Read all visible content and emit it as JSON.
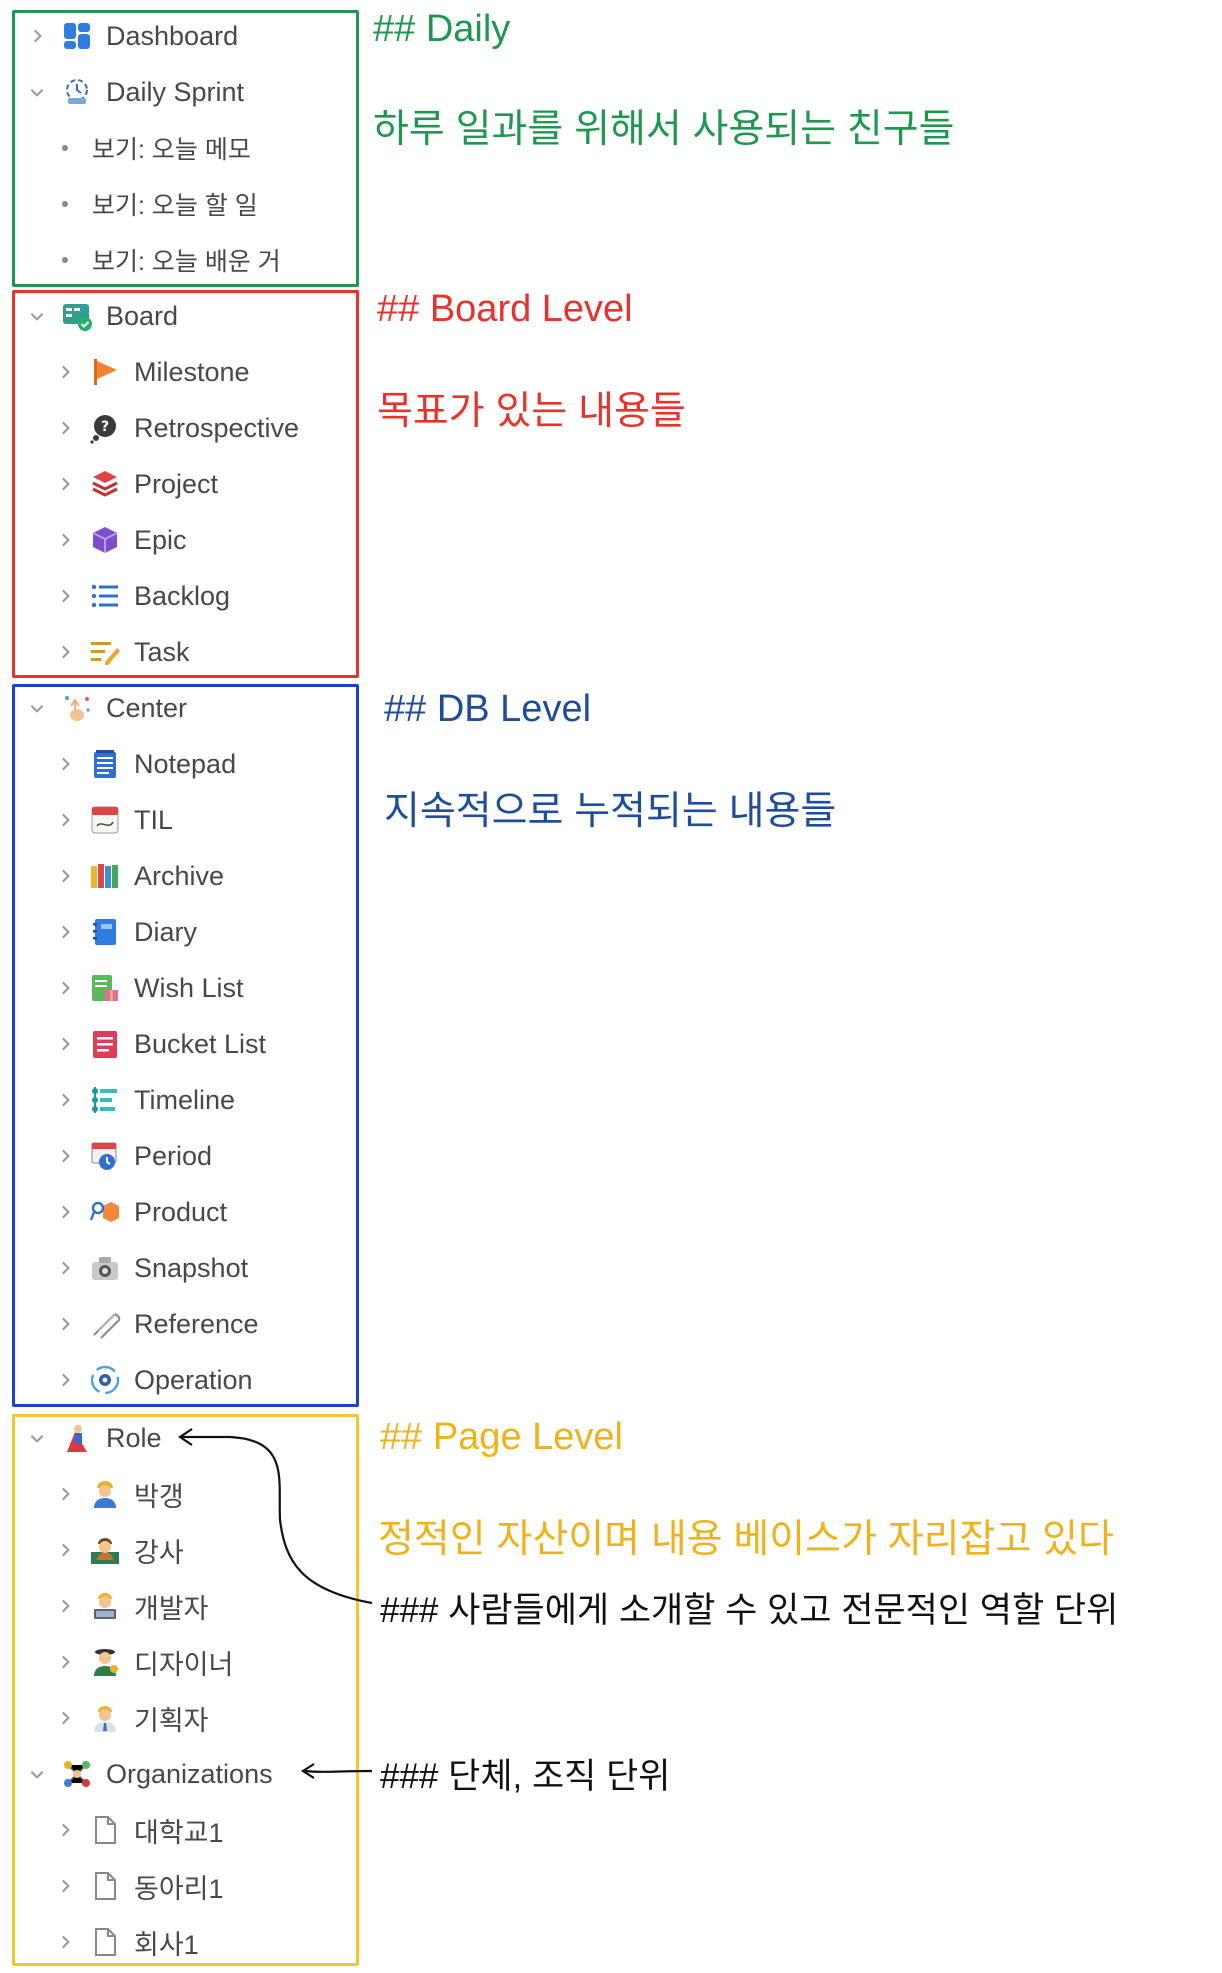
{
  "sidebar": {
    "daily": {
      "dashboard": "Dashboard",
      "daily_sprint": "Daily Sprint",
      "views": [
        "보기: 오늘 메모",
        "보기: 오늘 할 일",
        "보기: 오늘 배운 거"
      ]
    },
    "board": {
      "label": "Board",
      "items": [
        "Milestone",
        "Retrospective",
        "Project",
        "Epic",
        "Backlog",
        "Task"
      ]
    },
    "center": {
      "label": "Center",
      "items": [
        "Notepad",
        "TIL",
        "Archive",
        "Diary",
        "Wish List",
        "Bucket List",
        "Timeline",
        "Period",
        "Product",
        "Snapshot",
        "Reference",
        "Operation"
      ]
    },
    "role": {
      "label": "Role",
      "items": [
        "박갱",
        "강사",
        "개발자",
        "디자이너",
        "기획자"
      ]
    },
    "organizations": {
      "label": "Organizations",
      "items": [
        "대학교1",
        "동아리1",
        "회사1"
      ]
    }
  },
  "notes": {
    "daily_heading": "## Daily",
    "daily_desc": "하루 일과를 위해서 사용되는 친구들",
    "board_heading": "## Board Level",
    "board_desc": "목표가 있는 내용들",
    "db_heading": "## DB Level",
    "db_desc": "지속적으로 누적되는 내용들",
    "page_heading": "## Page Level",
    "page_desc": "정적인 자산이며 내용 베이스가 자리잡고 있다",
    "role_note": "### 사람들에게 소개할 수 있고 전문적인 역할 단위",
    "org_note": "### 단체, 조직 단위"
  },
  "colors": {
    "daily": "#1e9850",
    "board": "#e8322b",
    "db": "#1f3fd1",
    "page": "#f5c531",
    "text": "#4a4843"
  },
  "icons": {
    "dashboard": "dashboard-icon",
    "daily_sprint": "sprint-icon",
    "board": "board-icon",
    "milestone": "flag-icon",
    "retrospective": "thought-bubble-icon",
    "project": "stack-icon",
    "epic": "cube-icon",
    "backlog": "list-icon",
    "task": "pencil-list-icon",
    "center": "sparkle-hand-icon",
    "document": "page-icon"
  }
}
